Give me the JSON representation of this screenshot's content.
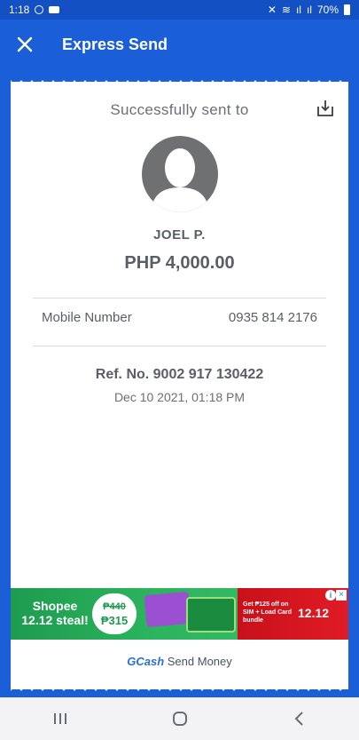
{
  "status_bar": {
    "time": "1:18",
    "battery": "70%"
  },
  "header": {
    "title": "Express Send"
  },
  "receipt": {
    "success_text": "Successfully sent to",
    "recipient_name": "JOEL P.",
    "amount": "PHP 4,000.00",
    "mobile_label": "Mobile Number",
    "mobile_value": "0935 814 2176",
    "ref_no": "Ref. No. 9002 917 130422",
    "datetime": "Dec 10 2021, 01:18 PM"
  },
  "ad": {
    "brand_line1": "Shopee",
    "brand_line2": "12.12 steal!",
    "price_old": "₱440",
    "price_new": "₱315",
    "promo_text": "Get ₱125 off on SIM + Load Card bundle",
    "date_text": "12.12"
  },
  "footer": {
    "brand": "GCash",
    "text": "Send Money"
  },
  "colors": {
    "primary_blue": "#1a5fd8",
    "text_gray": "#5a5e66",
    "avatar_gray": "#6f7072"
  }
}
